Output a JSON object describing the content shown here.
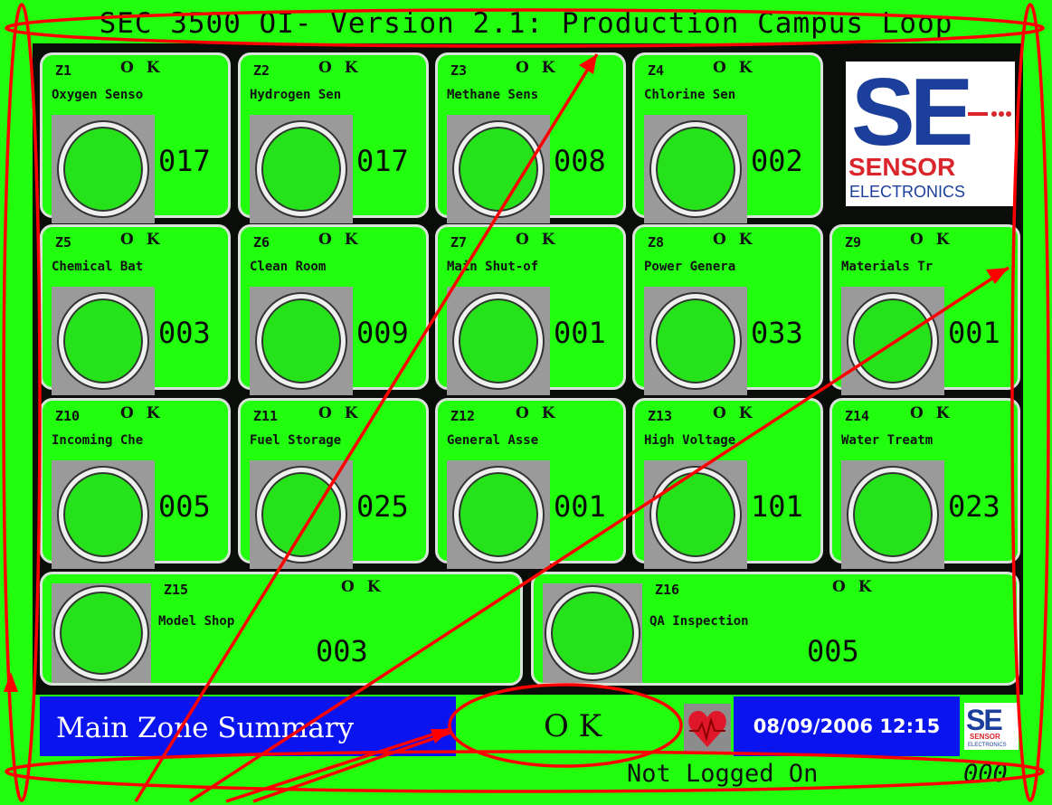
{
  "title": "SEC 3500 OI- Version 2.1: Production Campus Loop",
  "zones": [
    {
      "id": "Z1",
      "status": "O K",
      "name": "Oxygen Senso",
      "reading": "017"
    },
    {
      "id": "Z2",
      "status": "O K",
      "name": "Hydrogen Sen",
      "reading": "017"
    },
    {
      "id": "Z3",
      "status": "O K",
      "name": "Methane Sens",
      "reading": "008"
    },
    {
      "id": "Z4",
      "status": "O K",
      "name": "Chlorine Sen",
      "reading": "002"
    },
    {
      "id": "Z5",
      "status": "O K",
      "name": "Chemical Bat",
      "reading": "003"
    },
    {
      "id": "Z6",
      "status": "O K",
      "name": "Clean Room",
      "reading": "009"
    },
    {
      "id": "Z7",
      "status": "O K",
      "name": "Main Shut-of",
      "reading": "001"
    },
    {
      "id": "Z8",
      "status": "O K",
      "name": "Power Genera",
      "reading": "033"
    },
    {
      "id": "Z9",
      "status": "O K",
      "name": "Materials Tr",
      "reading": "001"
    },
    {
      "id": "Z10",
      "status": "O K",
      "name": "Incoming Che",
      "reading": "005"
    },
    {
      "id": "Z11",
      "status": "O K",
      "name": "Fuel Storage",
      "reading": "025"
    },
    {
      "id": "Z12",
      "status": "O K",
      "name": "General Asse",
      "reading": "001"
    },
    {
      "id": "Z13",
      "status": "O K",
      "name": "High Voltage",
      "reading": "101"
    },
    {
      "id": "Z14",
      "status": "O K",
      "name": "Water Treatm",
      "reading": "023"
    },
    {
      "id": "Z15",
      "status": "O K",
      "name": "Model Shop",
      "reading": "003"
    },
    {
      "id": "Z16",
      "status": "O K",
      "name": "QA Inspection",
      "reading": "005"
    }
  ],
  "logo": {
    "mark": "SE",
    "word1": "SENSOR",
    "word2": "ELECTRONICS"
  },
  "statusbar": {
    "screen_label": "Main Zone Summary",
    "system_status": "O K",
    "datetime": "08/09/2006 12:15",
    "login_status": "Not Logged On",
    "code": "000"
  },
  "colors": {
    "background": "#21ff0f",
    "panel": "#0b0d0b",
    "bar_blue": "#0a14ee",
    "lamp": "#26e21b",
    "annotation": "#ff0000",
    "logo_blue": "#1c3f9b",
    "logo_red": "#d9252b"
  },
  "icons": {
    "heartbeat": "heartbeat-icon",
    "logo": "sensor-electronics-logo"
  }
}
